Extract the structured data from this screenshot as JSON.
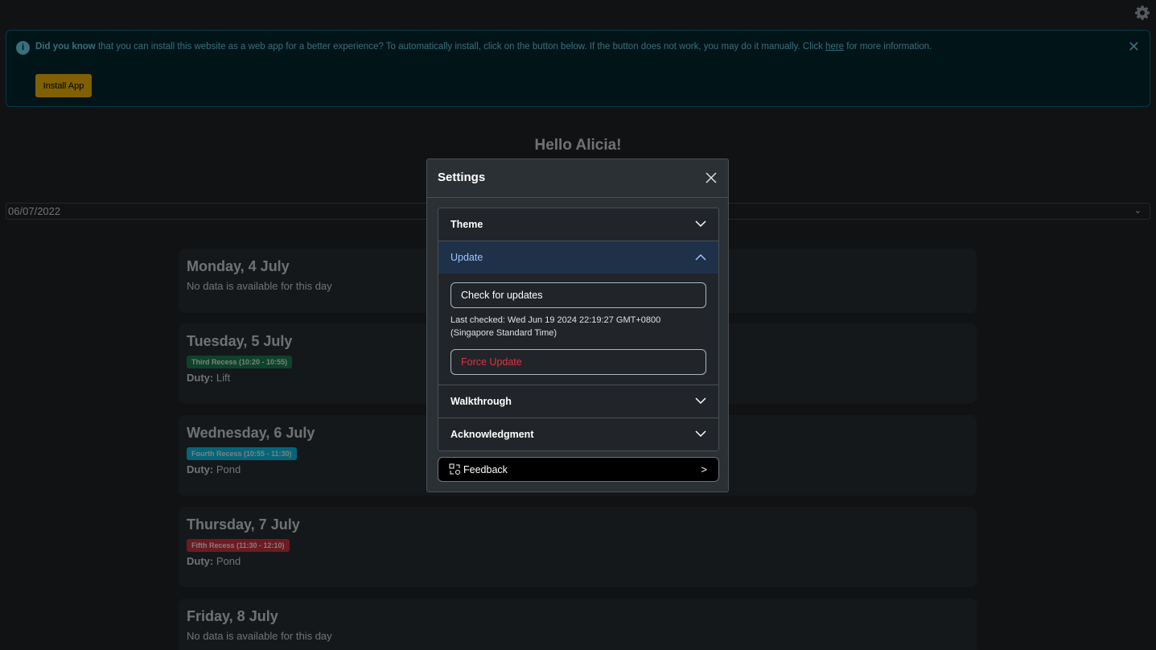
{
  "header": {
    "settings_icon": "gear-icon"
  },
  "alert": {
    "icon": "info-icon",
    "lead": "Did you know",
    "text_before": " that you can install this website as a web app for a better experience? To automatically install, click on the button below. If the button does not work, you may do it manually. Click ",
    "link": "here",
    "text_after": " for more information.",
    "close_icon": "close-icon",
    "install_label": "Install App"
  },
  "greeting": "Hello Alicia!",
  "date_input": {
    "day": "06",
    "sep1": "/",
    "month": "07",
    "sep2": "/",
    "year": "2022"
  },
  "days": [
    {
      "title": "Monday, 4 July",
      "note": "No data is available for this day"
    },
    {
      "title": "Tuesday, 5 July",
      "badge": "Third Recess (10:20 - 10:55)",
      "badge_color": "#198754",
      "duty_label": "Duty:",
      "duty": "Lift"
    },
    {
      "title": "Wednesday, 6 July",
      "badge": "Fourth Recess (10:55 - 11:30)",
      "badge_color": "#0dcaf0",
      "duty_label": "Duty:",
      "duty": "Pond"
    },
    {
      "title": "Thursday, 7 July",
      "badge": "Fifth Recess (11:30 - 12:10)",
      "badge_color": "#dc3545",
      "duty_label": "Duty:",
      "duty": "Pond"
    },
    {
      "title": "Friday, 8 July",
      "note": "No data is available for this day"
    }
  ],
  "modal": {
    "title": "Settings",
    "close_icon": "close-icon",
    "sections": {
      "theme": "Theme",
      "update": "Update",
      "walkthrough": "Walkthrough",
      "acknowledgment": "Acknowledgment"
    },
    "update": {
      "check_label": "Check for updates",
      "last_checked": "Last checked: Wed Jun 19 2024 22:19:27 GMT+0800 (Singapore Standard Time)",
      "force_label": "Force Update"
    },
    "feedback": {
      "label": "Feedback",
      "arrow": ">",
      "icon": "feedback-icon"
    }
  },
  "colors": {
    "background": "#212529",
    "alert_bg": "#032830",
    "install_button": "#ffc107",
    "active_section": "#1f3148",
    "force_update_text": "#dc3545"
  }
}
